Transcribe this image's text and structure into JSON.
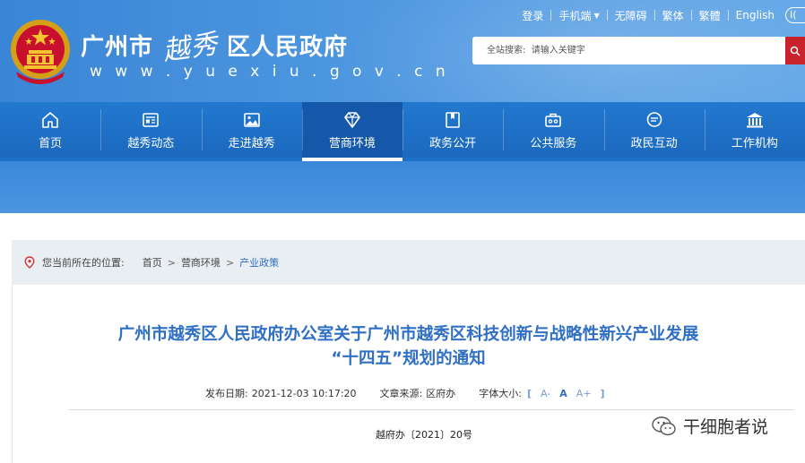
{
  "header": {
    "site_title_prefix": "广州市",
    "site_title_calligraphy": "越秀",
    "site_title_suffix": "区人民政府",
    "domain": "w w w . y u e x i u . g o v . c n",
    "colors": {
      "header_bg": "#4a92de",
      "nav_bg": "#1e6fc6",
      "nav_active": "#1557a8",
      "search_button": "#c8222a"
    }
  },
  "toplinks": {
    "login": "登录",
    "mobile": "手机端",
    "accessible": "无障碍",
    "traditional": "繁体",
    "simplified": "繁體",
    "english": "English",
    "last_pill": "I("
  },
  "search": {
    "label": "全站搜索:",
    "placeholder": "请输入关键字"
  },
  "nav": {
    "items": [
      {
        "label": "首页",
        "icon": "home-icon"
      },
      {
        "label": "越秀动态",
        "icon": "news-icon"
      },
      {
        "label": "走进越秀",
        "icon": "image-icon"
      },
      {
        "label": "营商环境",
        "icon": "diamond-icon"
      },
      {
        "label": "政务公开",
        "icon": "folder-icon"
      },
      {
        "label": "公共服务",
        "icon": "briefcase-icon"
      },
      {
        "label": "政民互动",
        "icon": "chat-icon"
      },
      {
        "label": "工作机构",
        "icon": "building-icon"
      }
    ],
    "active_index": 3
  },
  "breadcrumb": {
    "prefix": "您当前所在的位置:",
    "items": [
      "首页",
      "营商环境",
      "产业政策"
    ],
    "separator": ">"
  },
  "article": {
    "title_line1": "广州市越秀区人民政府办公室关于广州市越秀区科技创新与战略性新兴产业发展",
    "title_line2": "“十四五”规划的通知",
    "publish_label": "发布日期:",
    "publish_date": "2021-12-03 10:17:20",
    "source_label": "文章来源:",
    "source": "区府办",
    "font_size_label": "字体大小:",
    "font_small": "A-",
    "font_mid": "A",
    "font_large": "A+",
    "bracket_open": "[",
    "bracket_close": "]",
    "doc_number": "越府办〔2021〕20号"
  },
  "watermark": {
    "text": "干细胞者说"
  }
}
